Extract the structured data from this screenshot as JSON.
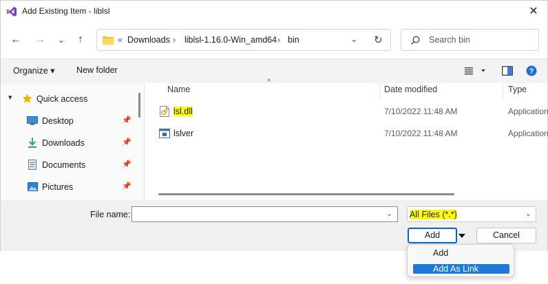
{
  "window": {
    "title": "Add Existing Item - liblsl",
    "close_glyph": "✕"
  },
  "nav": {
    "back_glyph": "←",
    "forward_glyph": "→",
    "recent_glyph": "⌄",
    "up_glyph": "↑",
    "breadcrumb": {
      "overflow": "«",
      "segments": [
        "Downloads",
        "liblsl-1.16.0-Win_amd64",
        "bin"
      ],
      "separator": "›",
      "dropdown_glyph": "⌄",
      "refresh_glyph": "↻"
    },
    "search": {
      "placeholder": "Search bin"
    }
  },
  "commandbar": {
    "organize_label": "Organize ▾",
    "new_folder_label": "New folder"
  },
  "sidebar": {
    "items": [
      {
        "label": "Quick access",
        "icon": "star-icon",
        "color": "#f0b400"
      },
      {
        "label": "Desktop",
        "icon": "desktop-icon",
        "color": "#3b8fd8",
        "pinned": true
      },
      {
        "label": "Downloads",
        "icon": "download-icon",
        "color": "#1a9c6c",
        "pinned": true
      },
      {
        "label": "Documents",
        "icon": "document-icon",
        "color": "#6b7a8c",
        "pinned": true
      },
      {
        "label": "Pictures",
        "icon": "pictures-icon",
        "color": "#2f7fd3",
        "pinned": true
      }
    ],
    "pin_glyph": "📌"
  },
  "filelist": {
    "columns": [
      "Name",
      "Date modified",
      "Type"
    ],
    "rows": [
      {
        "name": "lsl.dll",
        "date": "7/10/2022 11:48 AM",
        "type": "Application",
        "highlight": true,
        "icon": "dll-file-icon"
      },
      {
        "name": "lslver",
        "date": "7/10/2022 11:48 AM",
        "type": "Application",
        "highlight": false,
        "icon": "exe-file-icon"
      }
    ]
  },
  "footer": {
    "filename_label": "File name:",
    "filename_value": "",
    "filetype_value": "All Files (*.*)",
    "add_label": "Add",
    "cancel_label": "Cancel"
  },
  "add_menu": {
    "items": [
      "Add",
      "Add As Link"
    ],
    "selected_index": 1
  },
  "colors": {
    "highlight": "#ffff00",
    "accent": "#0067c0",
    "menu_selected": "#1e7ad6"
  }
}
